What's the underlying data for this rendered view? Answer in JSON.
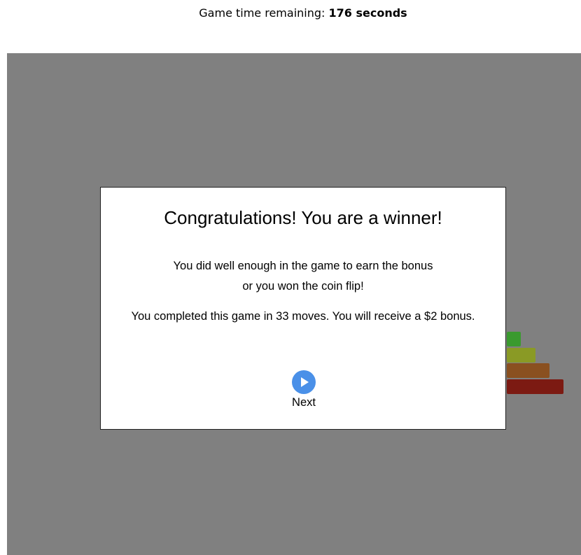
{
  "header": {
    "timer_label": "Game time remaining:",
    "timer_value": "176 seconds"
  },
  "game": {
    "background_color": "#808080",
    "disks": [
      {
        "color": "#3a9a2e"
      },
      {
        "color": "#8a9a25"
      },
      {
        "color": "#8a5020"
      },
      {
        "color": "#7c1a12"
      }
    ]
  },
  "modal": {
    "title": "Congratulations! You are a winner!",
    "message_line1": "You did well enough in the game to earn the bonus",
    "message_line2": "or you won the coin flip!",
    "result": "You completed this game in 33 moves. You will receive a $2 bonus.",
    "next_icon": "play-icon",
    "next_label": "Next",
    "accent_color": "#4a90e8"
  }
}
